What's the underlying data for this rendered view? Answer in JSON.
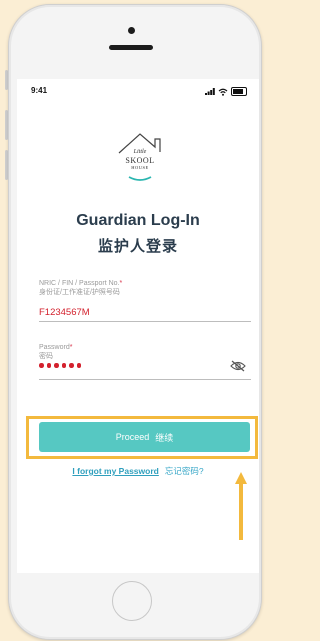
{
  "status": {
    "time": "9:41"
  },
  "logo": {
    "line1": "Little",
    "line2": "SKOOL",
    "line3": "HOUSE"
  },
  "header": {
    "title": "Guardian Log-In",
    "title_cn": "监护人登录"
  },
  "form": {
    "id_label": "NRIC / FIN / Passport No.",
    "id_label_cn": "身份证/工作准证/护照号码",
    "id_value": "F1234567M",
    "password_label": "Password",
    "password_label_cn": "密码",
    "required_mark": "*",
    "password_mask_count": 6
  },
  "actions": {
    "proceed_label": "Proceed",
    "proceed_label_cn": "继续",
    "forgot_label": "I forgot my Password",
    "forgot_label_cn": "忘记密码?"
  },
  "colors": {
    "accent": "#56c8c2",
    "highlight": "#f3b93d",
    "error_text": "#d3212d",
    "link": "#2f9fbd",
    "background": "#fbeed4"
  },
  "icons": {
    "eye_toggle": "eye-off-icon",
    "arrow": "arrow-up-icon"
  }
}
